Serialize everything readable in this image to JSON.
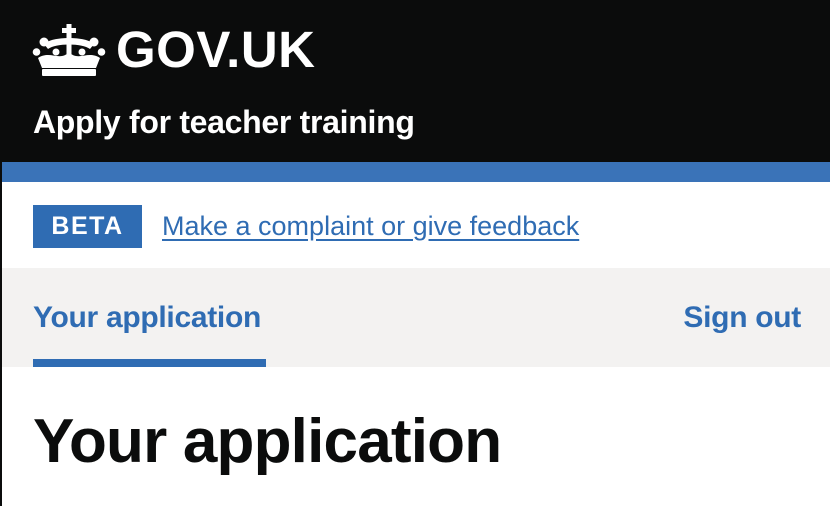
{
  "header": {
    "logo_text": "GOV.UK",
    "logo_icon": "crown-icon",
    "service_name": "Apply for teacher training"
  },
  "phase_banner": {
    "tag": "BETA",
    "link_text": "Make a complaint or give feedback"
  },
  "navigation": {
    "items": [
      {
        "label": "Your application",
        "active": true
      },
      {
        "label": "Sign out",
        "active": false
      }
    ]
  },
  "main": {
    "title": "Your application"
  },
  "colors": {
    "header_background": "#0b0c0c",
    "brand_blue": "#2f6cb3",
    "header_stripe": "#3a73b8",
    "nav_background": "#f3f2f1",
    "text": "#0b0c0c"
  }
}
